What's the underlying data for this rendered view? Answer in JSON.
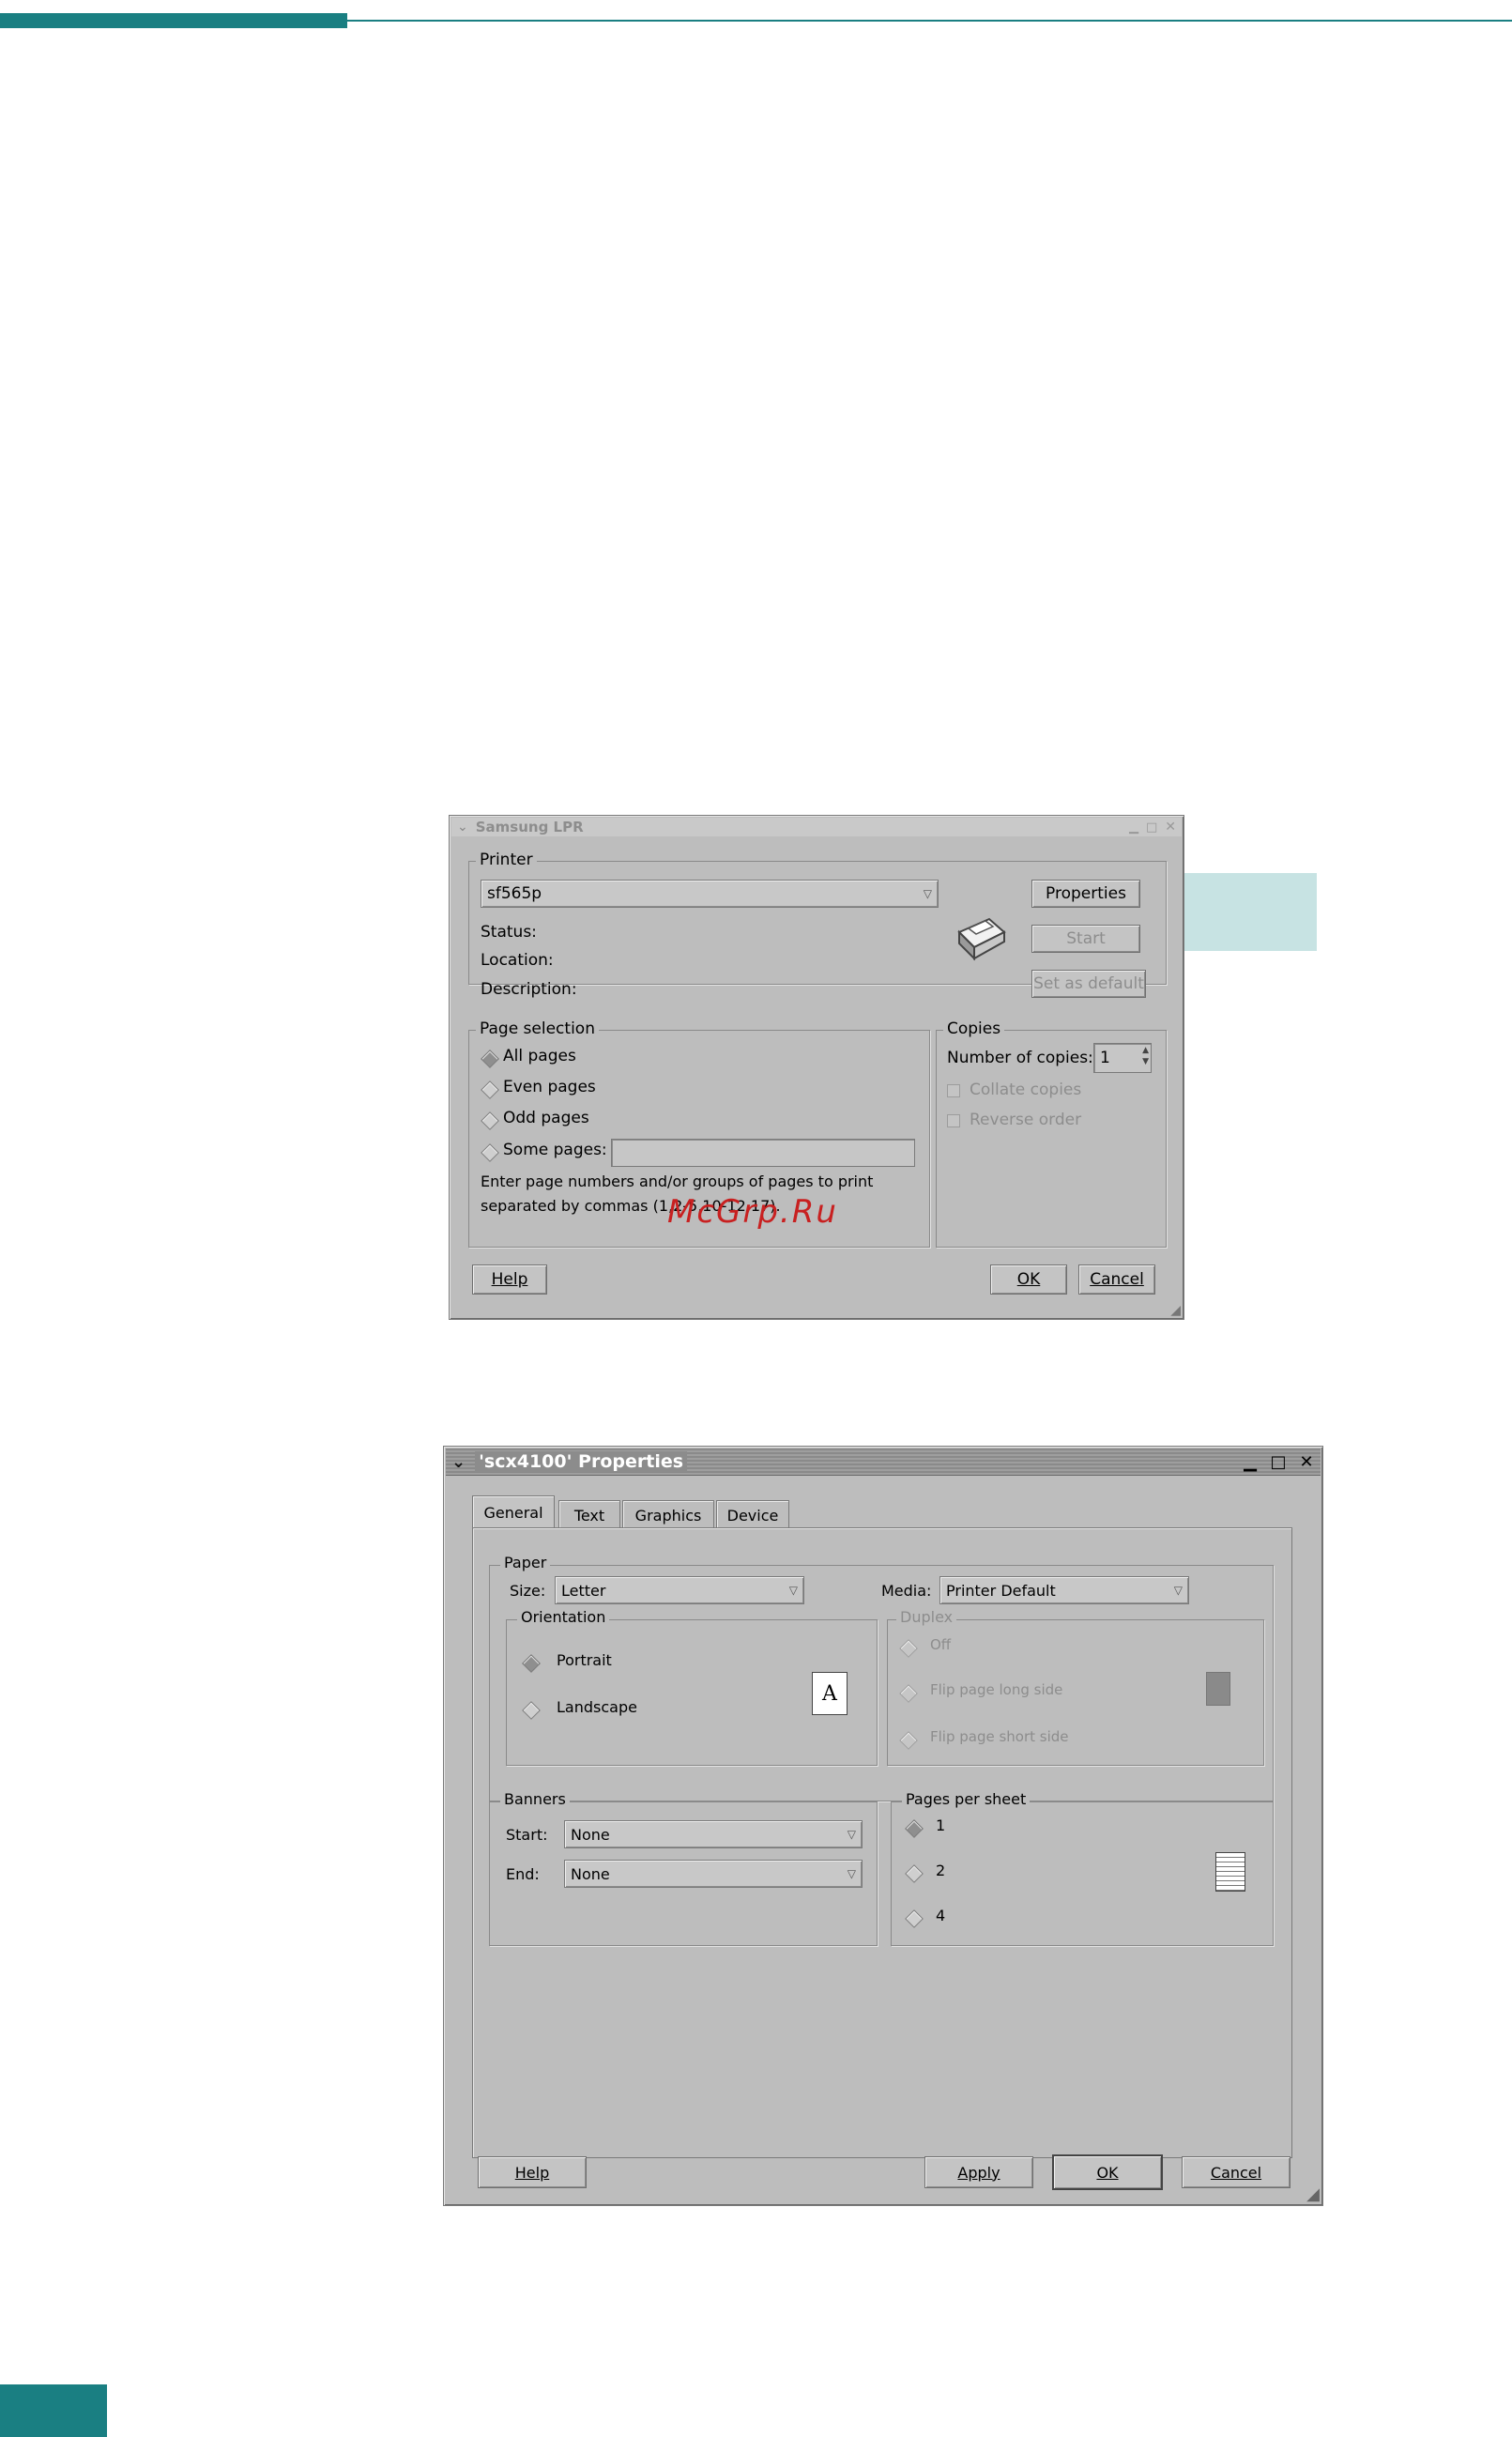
{
  "lpr": {
    "title": "Samsung LPR",
    "printer_group": "Printer",
    "printer_select": "sf565p",
    "status_label": "Status:",
    "location_label": "Location:",
    "description_label": "Description:",
    "properties_btn": "Properties",
    "start_btn": "Start",
    "set_default_btn": "Set as default",
    "page_selection_group": "Page selection",
    "all_pages": "All pages",
    "even_pages": "Even pages",
    "odd_pages": "Odd pages",
    "some_pages": "Some pages:",
    "hint_line1": "Enter page numbers and/or groups of pages to print",
    "hint_line2": "separated by commas (1,2-5,10-12,17).",
    "copies_group": "Copies",
    "number_of_copies": "Number of copies:",
    "copies_value": "1",
    "collate_copies": "Collate copies",
    "reverse_order": "Reverse order",
    "help_btn": "Help",
    "ok_btn": "OK",
    "cancel_btn": "Cancel",
    "watermark": "McGrp.Ru"
  },
  "props": {
    "title": "'scx4100' Properties",
    "tabs": [
      "General",
      "Text",
      "Graphics",
      "Device"
    ],
    "paper_group": "Paper",
    "size_label": "Size:",
    "size_value": "Letter",
    "media_label": "Media:",
    "media_value": "Printer Default",
    "orientation_group": "Orientation",
    "portrait": "Portrait",
    "landscape": "Landscape",
    "page_icon_letter": "A",
    "duplex_group": "Duplex",
    "duplex_off": "Off",
    "flip_long": "Flip page long side",
    "flip_short": "Flip page short side",
    "banners_group": "Banners",
    "start_label": "Start:",
    "start_value": "None",
    "end_label": "End:",
    "end_value": "None",
    "pps_group": "Pages per sheet",
    "pps_options": [
      "1",
      "2",
      "4"
    ],
    "help_btn": "Help",
    "apply_btn": "Apply",
    "ok_btn": "OK",
    "cancel_btn": "Cancel"
  },
  "colors": {
    "accent": "#1a7f82",
    "callout": "#c7e3e3",
    "window": "#bdbdbd"
  }
}
